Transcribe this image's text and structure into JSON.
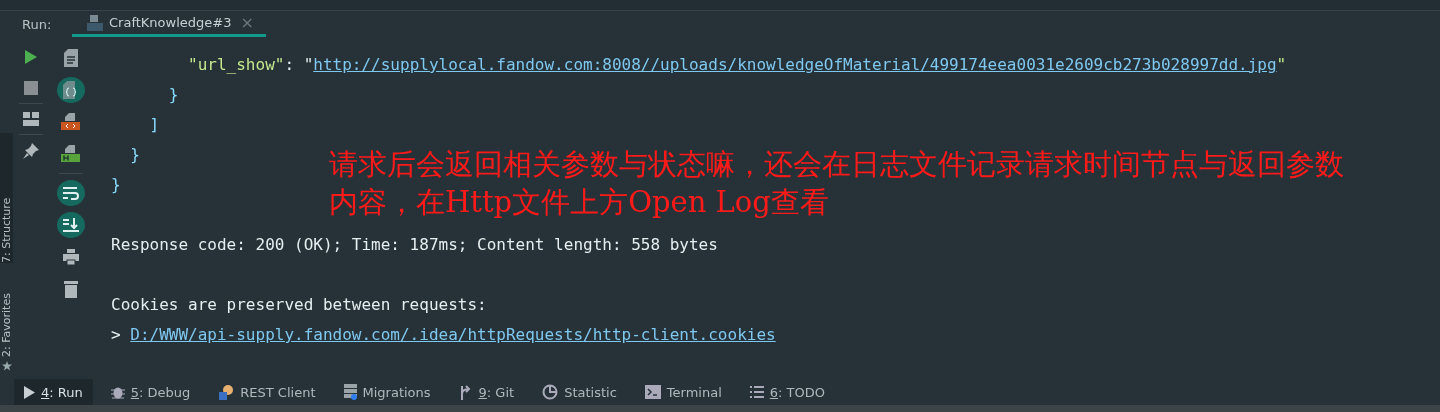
{
  "run_panel": {
    "label": "Run:",
    "tab": {
      "title": "CraftKnowledge#3",
      "close": "×",
      "selected": true
    }
  },
  "side_tool_windows": [
    {
      "label": "7: Structure"
    },
    {
      "label": "2: Favorites"
    }
  ],
  "toolbar": [
    {
      "kind": "run"
    },
    {
      "kind": "stop"
    },
    {
      "kind": "layout"
    },
    {
      "kind": "pin"
    }
  ],
  "output_toolbar": [
    {
      "kind": "doc",
      "selected": false
    },
    {
      "kind": "json",
      "selected": true
    },
    {
      "kind": "html",
      "selected": false
    },
    {
      "kind": "headers",
      "selected": false
    },
    {
      "kind": "wrap",
      "selected": true
    },
    {
      "kind": "scroll",
      "selected": true
    },
    {
      "kind": "print",
      "selected": false
    },
    {
      "kind": "trash",
      "selected": false
    }
  ],
  "output_blocks": [
    [
      {
        "segments": [
          {
            "kind": "key",
            "text": "        \"url_show\""
          },
          {
            "kind": "punct",
            "text": ": \""
          },
          {
            "kind": "link",
            "text": "http://supplylocal.fandow.com:8008//uploads/knowledgeOfMaterial/499174eea0031e2609cb273b028997dd.jpg"
          },
          {
            "kind": "key",
            "text": "\""
          }
        ]
      },
      {
        "segments": [
          {
            "kind": "brace",
            "text": "      }"
          }
        ]
      },
      {
        "segments": [
          {
            "kind": "brace",
            "text": "    ]"
          }
        ]
      },
      {
        "segments": [
          {
            "kind": "brace",
            "text": "  }"
          }
        ]
      },
      {
        "segments": [
          {
            "kind": "brace",
            "text": "}"
          }
        ]
      }
    ],
    [
      {
        "segments": [
          {
            "kind": "plain",
            "text": "Response code: 200 (OK); Time: 187ms; Content length: 558 bytes"
          }
        ]
      }
    ],
    [
      {
        "segments": [
          {
            "kind": "plain",
            "text": "Cookies are preserved between requests:"
          }
        ]
      },
      {
        "segments": [
          {
            "kind": "plain",
            "text": "> "
          },
          {
            "kind": "link",
            "text": "D:/WWW/api-supply.fandow.com/.idea/httpRequests/http-client.cookies"
          }
        ]
      }
    ]
  ],
  "annotation": "请求后会返回相关参数与状态嘛，还会在日志文件记录请求时间节点与返回参数内容，在Http文件上方Open Log查看",
  "bottom_tools": [
    {
      "kind": "run",
      "mnemonic": "4",
      "label": ": Run",
      "selected": true
    },
    {
      "kind": "debug",
      "mnemonic": "5",
      "label": ": Debug",
      "selected": false
    },
    {
      "kind": "rest",
      "label": "REST Client",
      "selected": false
    },
    {
      "kind": "db",
      "label": "Migrations",
      "selected": false
    },
    {
      "kind": "git",
      "mnemonic": "9",
      "label": ": Git",
      "selected": false
    },
    {
      "kind": "stat",
      "label": "Statistic",
      "selected": false
    },
    {
      "kind": "terminal",
      "label": "Terminal",
      "selected": false
    },
    {
      "kind": "todo",
      "mnemonic": "6",
      "label": ": TODO",
      "selected": false
    }
  ]
}
